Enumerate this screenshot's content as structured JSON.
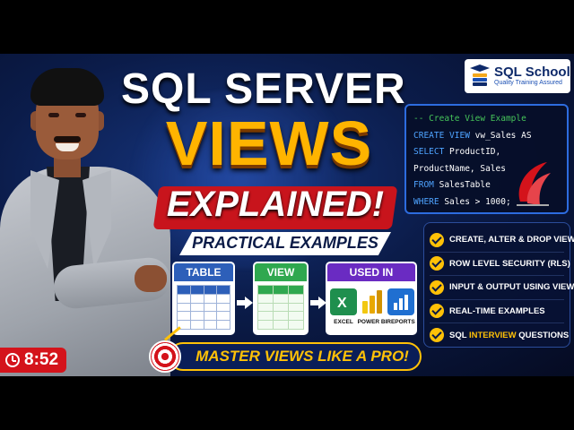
{
  "title": {
    "line1": "SQL SERVER",
    "line2": "VIEWS",
    "line3": "EXPLAINED!",
    "subtitle": "PRACTICAL EXAMPLES"
  },
  "logo": {
    "name": "SQL School",
    "tagline": "Quality Training Assured"
  },
  "code": {
    "comment": "-- Create View Example",
    "lines": [
      {
        "kw": "CREATE VIEW",
        "rest": " vw_Sales AS"
      },
      {
        "kw": "SELECT",
        "rest": " ProductID,"
      },
      {
        "kw": "",
        "rest": "ProductName, Sales"
      },
      {
        "kw": "FROM",
        "rest": " SalesTable"
      },
      {
        "kw": "WHERE",
        "rest": " Sales > 1000;"
      }
    ]
  },
  "features": [
    {
      "before": "CREATE, ALTER & DROP VIEW",
      "highlight": "",
      "after": ""
    },
    {
      "before": "ROW LEVEL SECURITY (RLS)",
      "highlight": "",
      "after": ""
    },
    {
      "before": "INPUT & OUTPUT USING VIEWS",
      "highlight": "",
      "after": ""
    },
    {
      "before": "REAL-TIME EXAMPLES",
      "highlight": "",
      "after": ""
    },
    {
      "before": "SQL ",
      "highlight": "INTERVIEW",
      "after": " QUESTIONS"
    }
  ],
  "diagram": {
    "table_label": "TABLE",
    "view_label": "VIEW",
    "used_label": "USED IN",
    "apps": [
      "EXCEL",
      "POWER BI",
      "REPORTS"
    ]
  },
  "banner": "MASTER VIEWS LIKE A PRO!",
  "duration": "8:52",
  "colors": {
    "accent_yellow": "#ffb400",
    "accent_red": "#c8141c",
    "navy": "#0a1e58",
    "code_blue": "#4ea3ff",
    "code_green": "#46c45a"
  }
}
